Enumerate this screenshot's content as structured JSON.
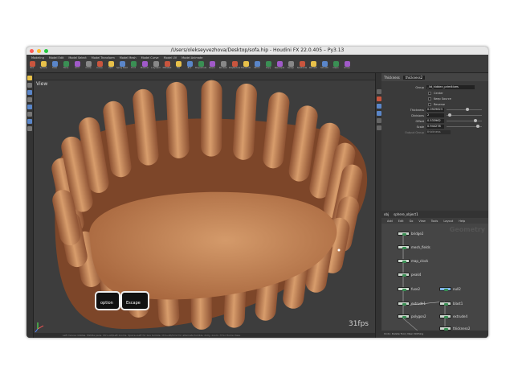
{
  "window": {
    "title": "/Users/olekseyvezhova/Desktop/sofa.hip - Houdini FX 22.0.405 – Py3.13",
    "menu": [
      "Modeling",
      "Model Edit",
      "Model Select",
      "Model Transform",
      "Model Mesh",
      "Model Curve",
      "Model UV",
      "Model Animate"
    ],
    "shelf_tools": [
      "Box",
      "Sphere",
      "Tube",
      "Torus",
      "Grid",
      "Circle",
      "Curve",
      "Path",
      "Spray Paint",
      "Font",
      "Platonic",
      "L-System",
      "Metaball",
      "File",
      "Box",
      "Polyextrude",
      "Bevel",
      "Boolean",
      "PolyReduce",
      "Transform",
      "Mirror",
      "Copy",
      "Resample",
      "Sweep",
      "Subdivide",
      "Remesh",
      "Smooth",
      "Clean",
      "Group"
    ]
  },
  "viewport": {
    "view_label": "View",
    "fps": "31fps",
    "status": "Left mouse rotates. Middle pans. Ctrl+Alt/Left zooms. Space+Left for box tumble. Ctrl+Alt/Cmd for alternate tumble, dolly, zoom. H for Home View."
  },
  "params": {
    "node_type": "Thickness",
    "node_name": "thickness2",
    "group_label": "Group",
    "group_value": "_lid_hidden_primitives",
    "checkboxes": [
      "Center",
      "Keep Source",
      "Reverse"
    ],
    "rows": [
      {
        "label": "Thickness",
        "value": "0.0929623",
        "knob": 0.6
      },
      {
        "label": "Divisions",
        "value": "2",
        "knob": 0.05
      },
      {
        "label": "Offset",
        "value": "0.533962",
        "knob": 0.85
      },
      {
        "label": "Scale",
        "value": "0.944278",
        "knob": 0.92
      }
    ],
    "extra_label": "Output Group",
    "extra_value": "thickness"
  },
  "network": {
    "path": "obj",
    "object": "sphere_object1",
    "menu": [
      "Add",
      "Edit",
      "Go",
      "View",
      "Tools",
      "Layout",
      "Help"
    ],
    "context_label": "Geometry",
    "nodes": [
      "bridge2",
      "mesh_fields",
      "map_clock",
      "peak4",
      "fuse2",
      "null2",
      "extrude1",
      "blast1",
      "polygon2",
      "extrude4",
      "thickness2",
      "merge1"
    ],
    "status": "Undo: Delete Tool | Nsw: Nothing"
  },
  "keys": {
    "option": "option",
    "escape": "Escape"
  },
  "colors": {
    "sofa": "#c98a5c",
    "viewport_bg": "#3d3d3d",
    "panel_bg": "#3a3a3a",
    "node_green": "#3a8f54"
  }
}
